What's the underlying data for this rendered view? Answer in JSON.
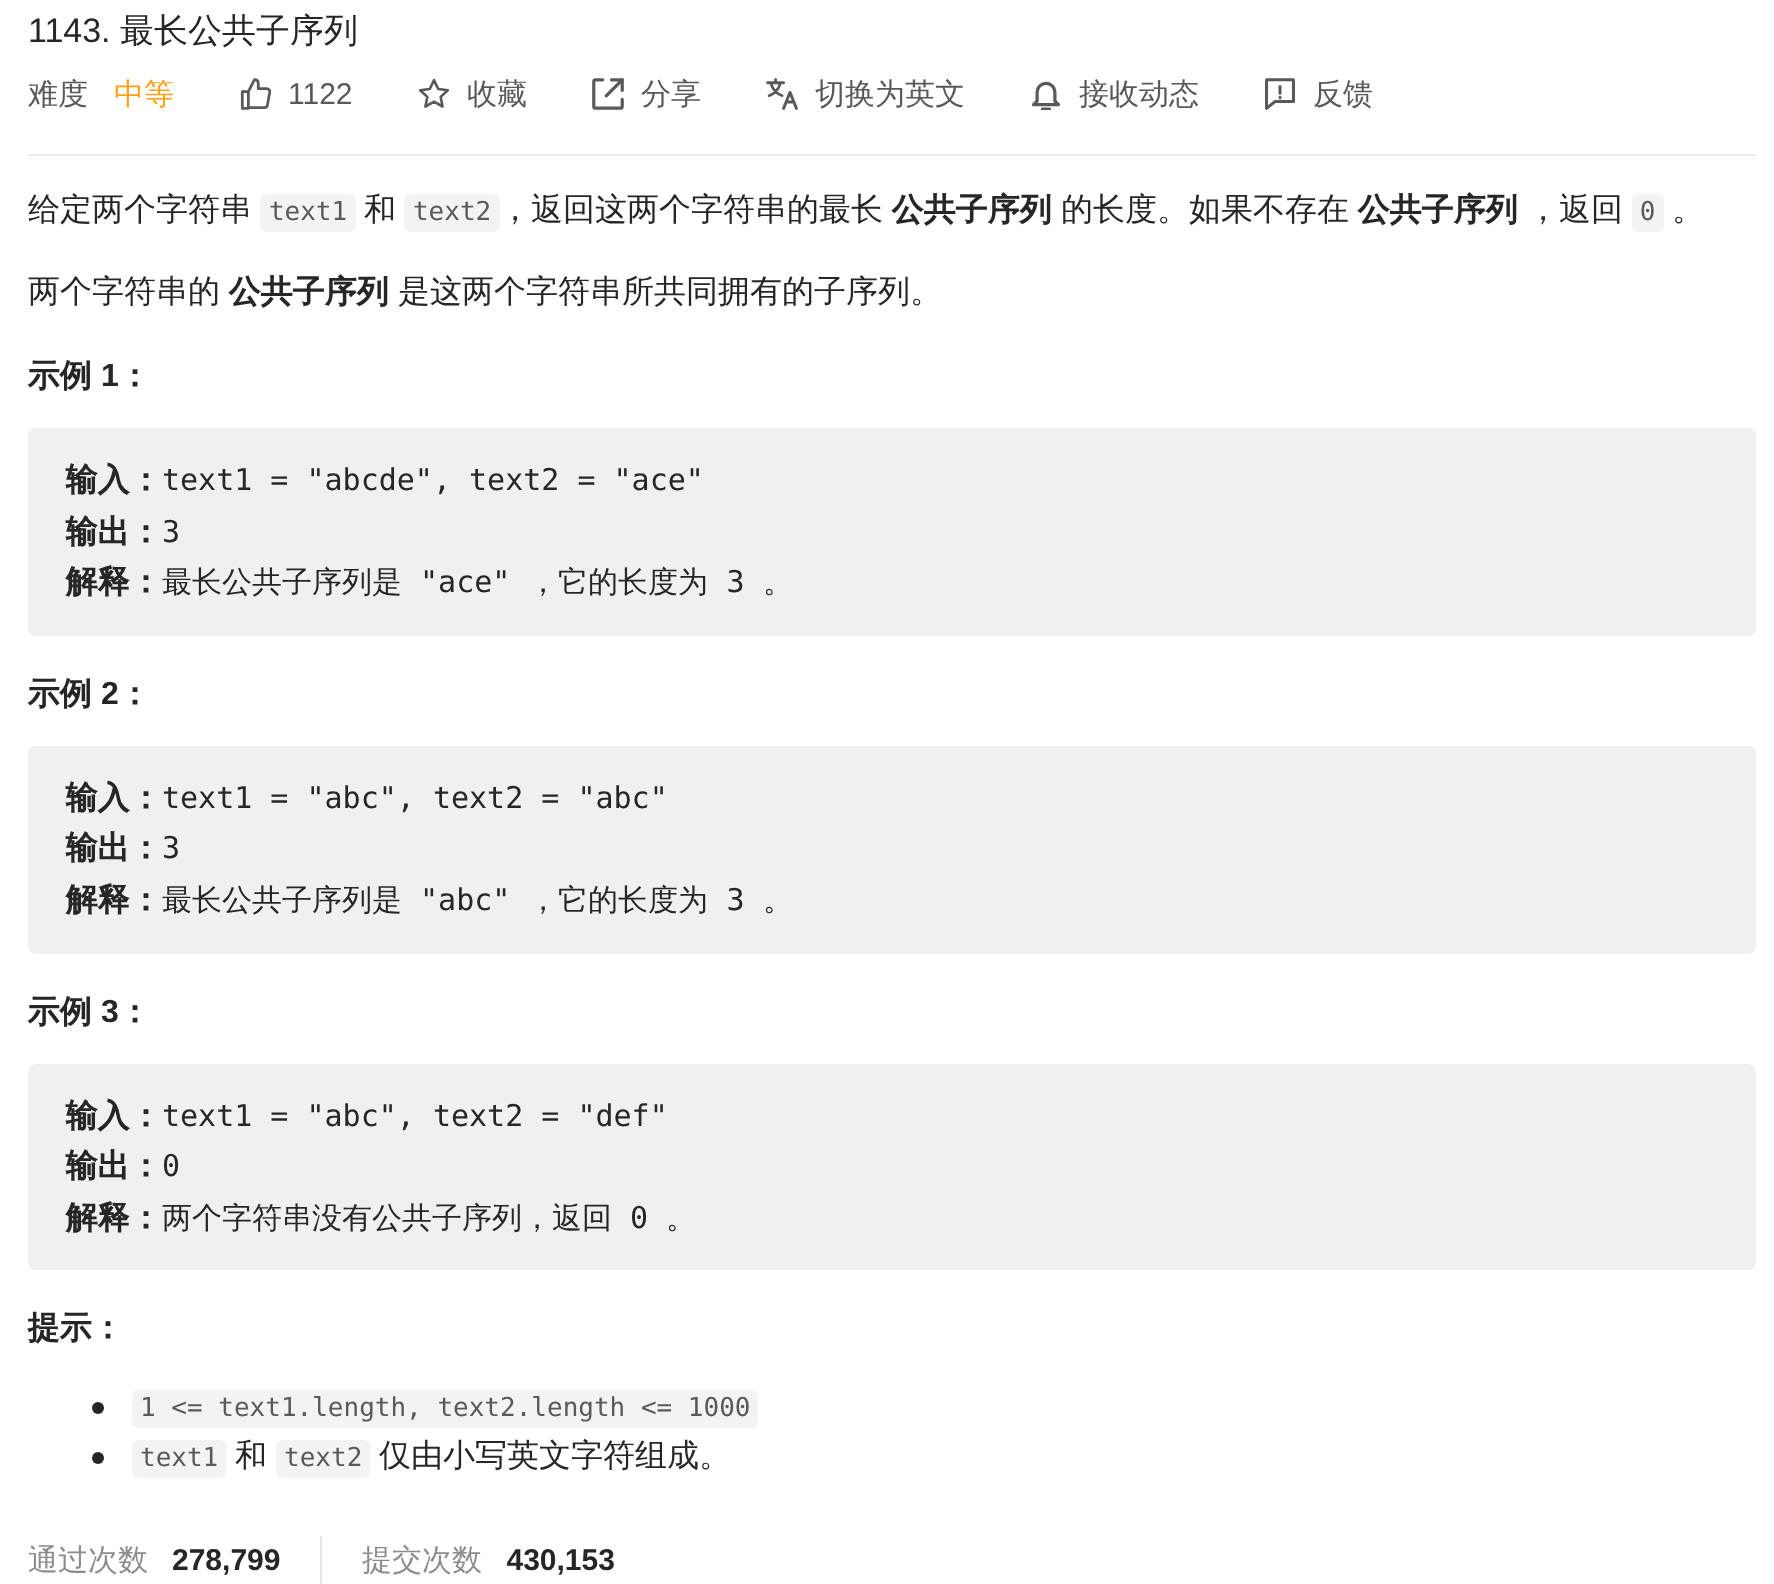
{
  "title": "1143. 最长公共子序列",
  "meta": {
    "difficulty_label": "难度",
    "difficulty": "中等",
    "actions": [
      {
        "kind": "like",
        "label": "1122"
      },
      {
        "kind": "star",
        "label": "收藏"
      },
      {
        "kind": "share",
        "label": "分享"
      },
      {
        "kind": "translate",
        "label": "切换为英文"
      },
      {
        "kind": "bell",
        "label": "接收动态"
      },
      {
        "kind": "feedback",
        "label": "反馈"
      }
    ]
  },
  "description": [
    {
      "segments": [
        {
          "kind": "text",
          "text": "给定两个字符串 "
        },
        {
          "kind": "code",
          "text": "text1"
        },
        {
          "kind": "text",
          "text": " 和 "
        },
        {
          "kind": "code",
          "text": "text2"
        },
        {
          "kind": "text",
          "text": "，返回这两个字符串的最长 **公共子序列** 的长度。如果不存在 **公共子序列** ，返回 "
        },
        {
          "kind": "code",
          "text": "0"
        },
        {
          "kind": "text",
          "text": " 。"
        }
      ]
    },
    {
      "segments": [
        {
          "kind": "text",
          "text": "两个字符串的 **公共子序列** 是这两个字符串所共同拥有的子序列。"
        }
      ]
    }
  ],
  "examples": [
    {
      "heading": "示例 1：",
      "lines": [
        "**输入：**text1 = \"abcde\", text2 = \"ace\"",
        "**输出：**3",
        "**解释：**最长公共子序列是 \"ace\" ，它的长度为 3 。"
      ]
    },
    {
      "heading": "示例 2：",
      "lines": [
        "**输入：**text1 = \"abc\", text2 = \"abc\"",
        "**输出：**3",
        "**解释：**最长公共子序列是 \"abc\" ，它的长度为 3 。"
      ]
    },
    {
      "heading": "示例 3：",
      "lines": [
        "**输入：**text1 = \"abc\", text2 = \"def\"",
        "**输出：**0",
        "**解释：**两个字符串没有公共子序列，返回 0 。"
      ]
    }
  ],
  "hints": {
    "heading": "提示：",
    "items": [
      {
        "segments": [
          {
            "kind": "code",
            "text": "1 <= text1.length, text2.length <= 1000"
          }
        ]
      },
      {
        "segments": [
          {
            "kind": "code",
            "text": "text1"
          },
          {
            "kind": "text",
            "text": " 和 "
          },
          {
            "kind": "code",
            "text": "text2"
          },
          {
            "kind": "text",
            "text": " 仅由小写英文字符组成。"
          }
        ]
      }
    ]
  },
  "stats": [
    {
      "label": "通过次数",
      "value": "278,799"
    },
    {
      "label": "提交次数",
      "value": "430,153"
    }
  ]
}
